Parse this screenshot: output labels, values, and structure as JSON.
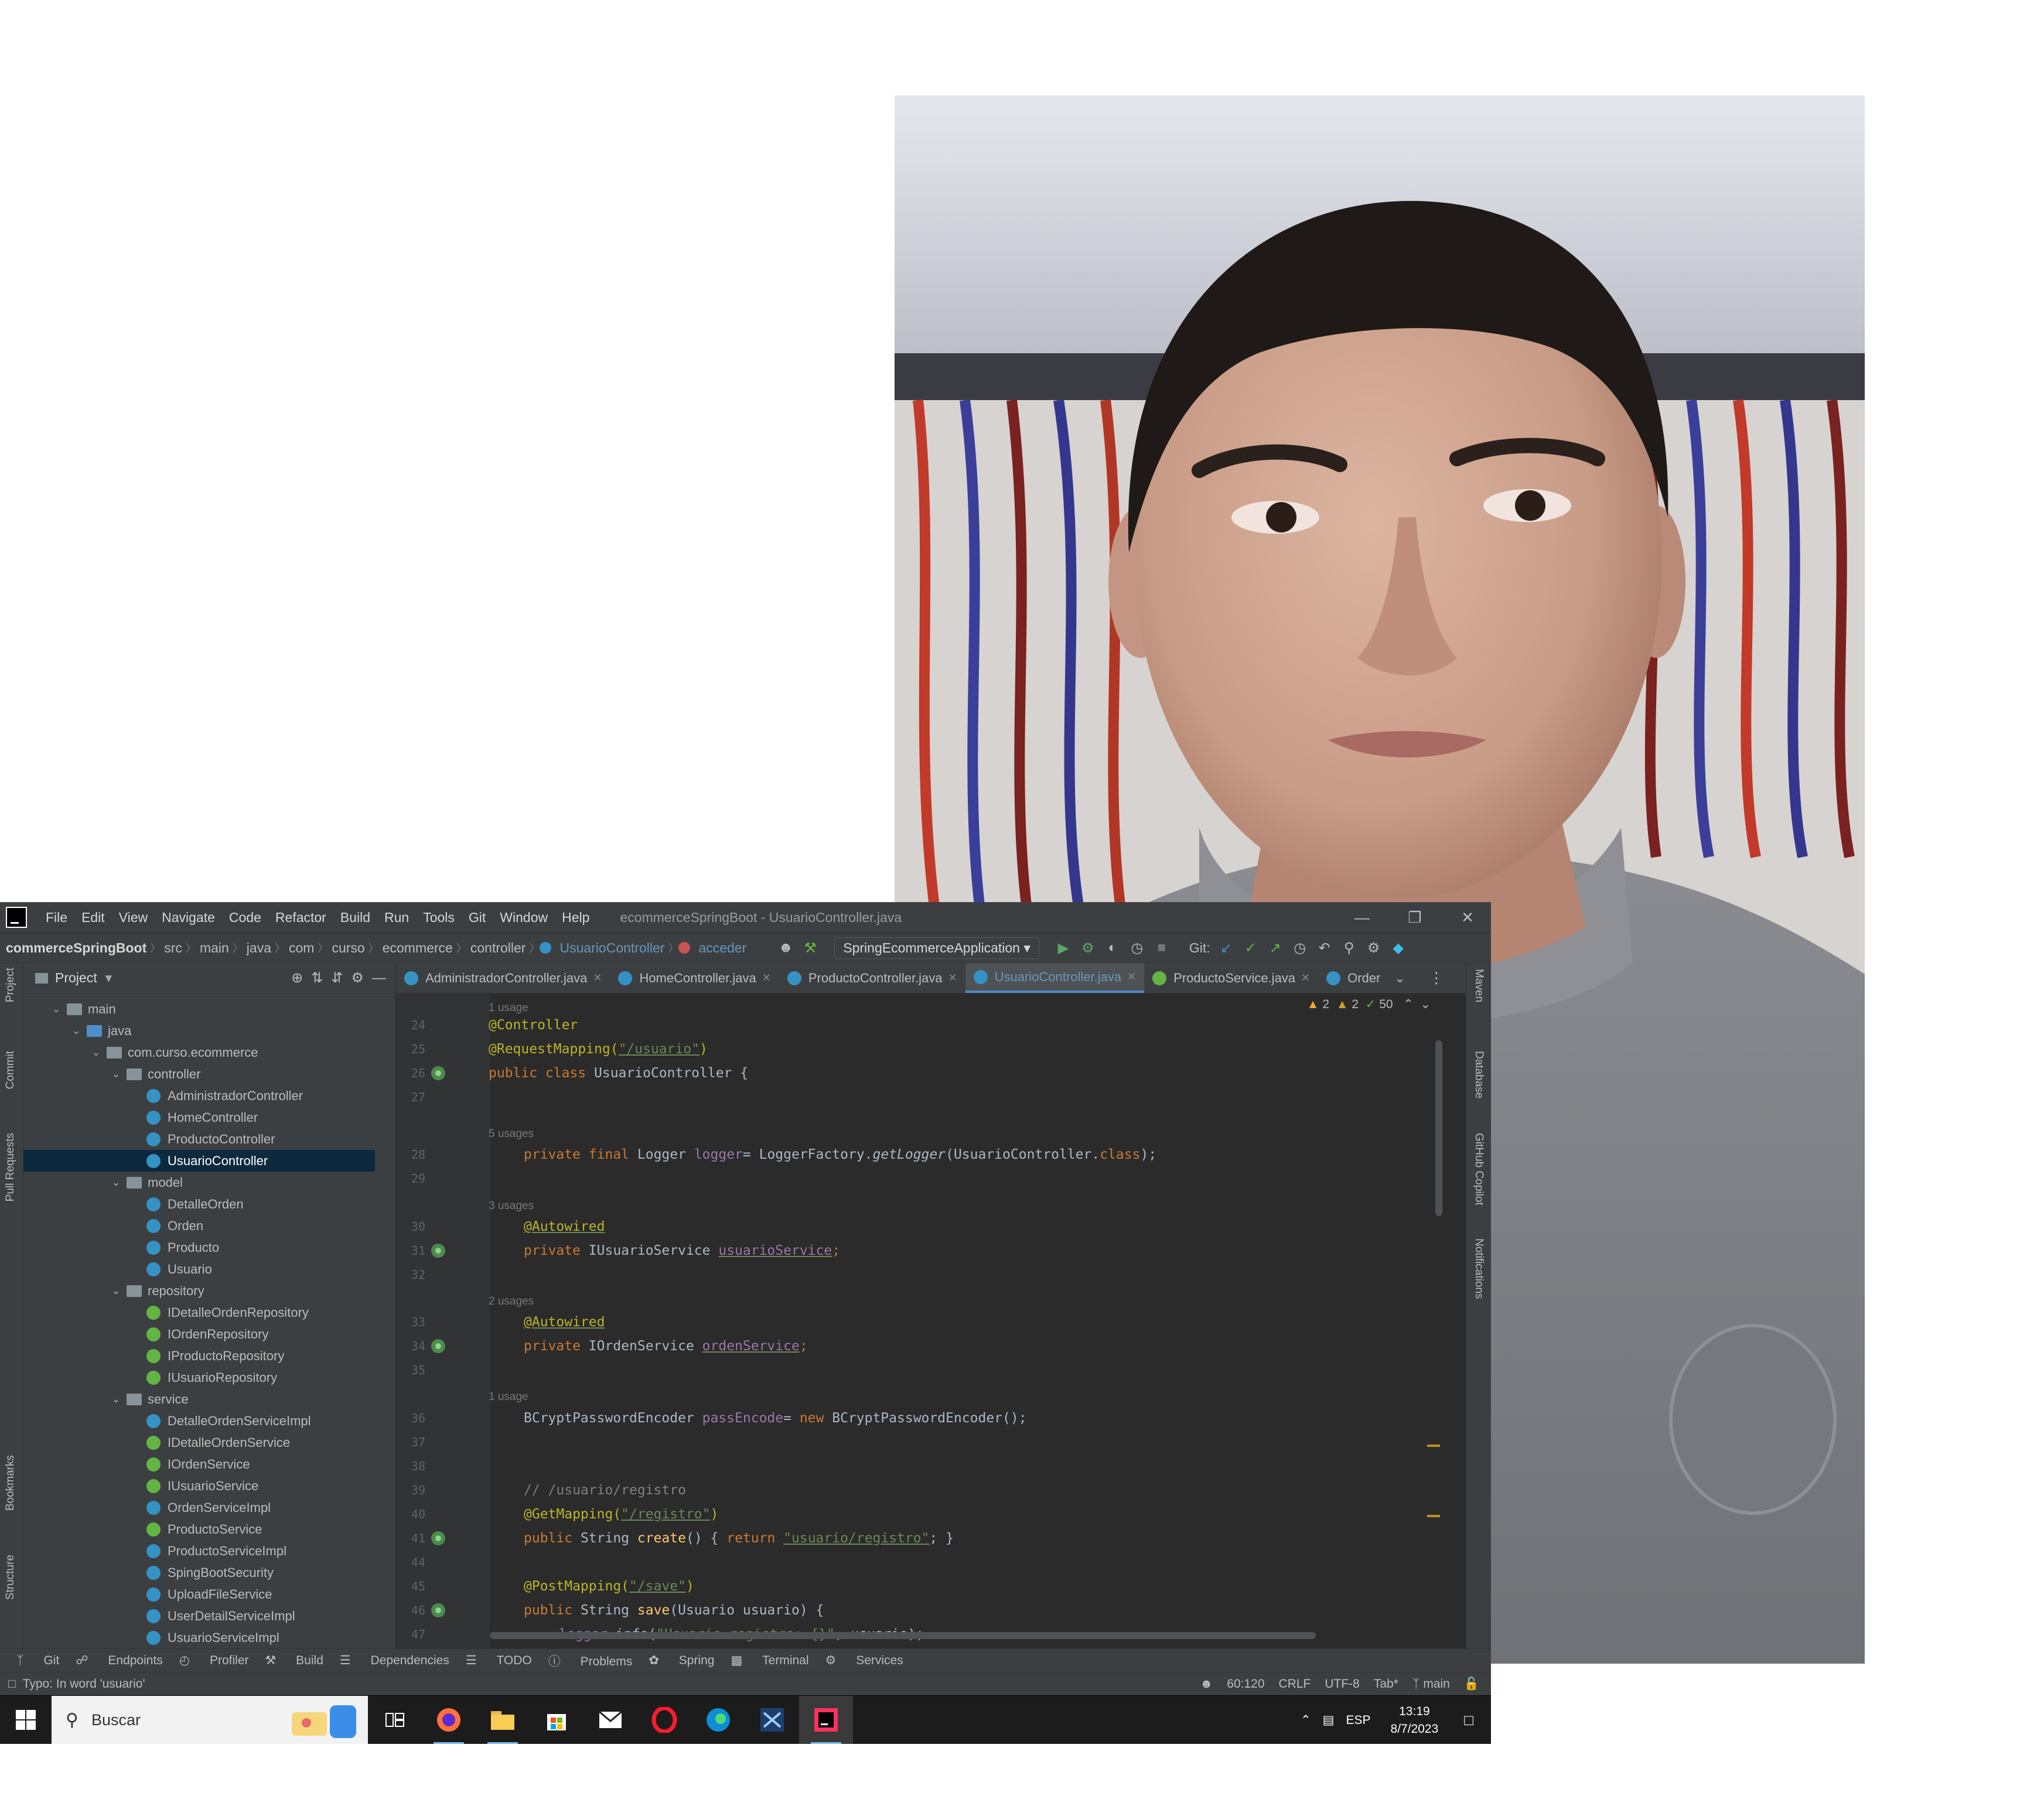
{
  "ide": {
    "menu": [
      "File",
      "Edit",
      "View",
      "Navigate",
      "Code",
      "Refactor",
      "Build",
      "Run",
      "Tools",
      "Git",
      "Window",
      "Help"
    ],
    "window_title": "ecommerceSpringBoot - UsuarioController.java",
    "breadcrumbs": [
      "commerceSpringBoot",
      "src",
      "main",
      "java",
      "com",
      "curso",
      "ecommerce",
      "controller"
    ],
    "breadcrumb_class": "UsuarioController",
    "breadcrumb_method": "acceder",
    "run_config": "SpringEcommerceApplication",
    "git_label": "Git:",
    "project_label": "Project",
    "left_stripe": [
      "Project",
      "Commit",
      "Pull Requests",
      "Bookmarks",
      "Structure"
    ],
    "right_stripe": [
      "Maven",
      "Database",
      "GitHub Copilot",
      "Notifications"
    ],
    "tree": [
      {
        "label": "main",
        "type": "folder",
        "depth": 0
      },
      {
        "label": "java",
        "type": "folder-blue",
        "depth": 1
      },
      {
        "label": "com.curso.ecommerce",
        "type": "folder",
        "depth": 2
      },
      {
        "label": "controller",
        "type": "folder",
        "depth": 3
      },
      {
        "label": "AdministradorController",
        "type": "class",
        "depth": 4
      },
      {
        "label": "HomeController",
        "type": "class",
        "depth": 4
      },
      {
        "label": "ProductoController",
        "type": "class",
        "depth": 4
      },
      {
        "label": "UsuarioController",
        "type": "class",
        "depth": 4,
        "selected": true
      },
      {
        "label": "model",
        "type": "folder",
        "depth": 3
      },
      {
        "label": "DetalleOrden",
        "type": "class",
        "depth": 4
      },
      {
        "label": "Orden",
        "type": "class",
        "depth": 4
      },
      {
        "label": "Producto",
        "type": "class",
        "depth": 4
      },
      {
        "label": "Usuario",
        "type": "class",
        "depth": 4
      },
      {
        "label": "repository",
        "type": "folder",
        "depth": 3
      },
      {
        "label": "IDetalleOrdenRepository",
        "type": "interface",
        "depth": 4
      },
      {
        "label": "IOrdenRepository",
        "type": "interface",
        "depth": 4
      },
      {
        "label": "IProductoRepository",
        "type": "interface",
        "depth": 4
      },
      {
        "label": "IUsuarioRepository",
        "type": "interface",
        "depth": 4
      },
      {
        "label": "service",
        "type": "folder",
        "depth": 3
      },
      {
        "label": "DetalleOrdenServiceImpl",
        "type": "class",
        "depth": 4
      },
      {
        "label": "IDetalleOrdenService",
        "type": "interface",
        "depth": 4
      },
      {
        "label": "IOrdenService",
        "type": "interface",
        "depth": 4
      },
      {
        "label": "IUsuarioService",
        "type": "interface",
        "depth": 4
      },
      {
        "label": "OrdenServiceImpl",
        "type": "class",
        "depth": 4
      },
      {
        "label": "ProductoService",
        "type": "interface",
        "depth": 4
      },
      {
        "label": "ProductoServiceImpl",
        "type": "class",
        "depth": 4
      },
      {
        "label": "SpingBootSecurity",
        "type": "class",
        "depth": 4
      },
      {
        "label": "UploadFileService",
        "type": "class",
        "depth": 4
      },
      {
        "label": "UserDetailServiceImpl",
        "type": "class",
        "depth": 4
      },
      {
        "label": "UsuarioServiceImpl",
        "type": "class",
        "depth": 4
      }
    ],
    "tabs": [
      {
        "label": "AdministradorController.java",
        "icon": "class"
      },
      {
        "label": "HomeController.java",
        "icon": "class"
      },
      {
        "label": "ProductoController.java",
        "icon": "class"
      },
      {
        "label": "UsuarioController.java",
        "icon": "class",
        "active": true
      },
      {
        "label": "ProductoService.java",
        "icon": "interface"
      },
      {
        "label": "Order",
        "icon": "class"
      }
    ],
    "inspections": {
      "warn1": "2",
      "warn2": "2",
      "ok": "50"
    },
    "hints": {
      "h24": "1 usage",
      "h28": "5 usages",
      "h30": "3 usages",
      "h33": "2 usages",
      "h36": "1 usage"
    },
    "line_numbers": [
      "24",
      "25",
      "26",
      "27",
      "28",
      "29",
      "30",
      "31",
      "32",
      "33",
      "34",
      "35",
      "36",
      "37",
      "38",
      "39",
      "40",
      "41",
      "44",
      "45",
      "46",
      "47"
    ],
    "code": {
      "l24": "@Controller",
      "l25a": "@RequestMapping(",
      "l25b": "\"/usuario\"",
      "l25c": ")",
      "l26a": "public class ",
      "l26b": "UsuarioController",
      "l26c": " {",
      "l28a": "private final ",
      "l28b": "Logger ",
      "l28c": "logger",
      "l28d": "= LoggerFactory.",
      "l28e": "getLogger",
      "l28f": "(UsuarioController.",
      "l28g": "class",
      "l28h": ");",
      "l30": "@Autowired",
      "l31a": "private ",
      "l31b": "IUsuarioService ",
      "l31c": "usuarioService",
      "l31d": ";",
      "l33": "@Autowired",
      "l34a": "private ",
      "l34b": "IOrdenService ",
      "l34c": "ordenService",
      "l34d": ";",
      "l36a": "BCryptPasswordEncoder ",
      "l36b": "passEncode",
      "l36c": "= ",
      "l36d": "new ",
      "l36e": "BCryptPasswordEncoder();",
      "l39": "// /usuario/registro",
      "l40a": "@GetMapping(",
      "l40b": "\"/registro\"",
      "l40c": ")",
      "l41a": "public ",
      "l41b": "String ",
      "l41c": "create",
      "l41d": "() { ",
      "l41e": "return ",
      "l41f": "\"usuario/registro\"",
      "l41g": "; }",
      "l45a": "@PostMapping(",
      "l45b": "\"/save\"",
      "l45c": ")",
      "l46a": "public ",
      "l46b": "String ",
      "l46c": "save",
      "l46d": "(Usuario usuario) {",
      "l47a": "logger",
      "l47b": ".info(",
      "l47c": "\"Usuario registro: {}\"",
      "l47d": ", usuario);"
    },
    "toolwindows": [
      "Git",
      "Endpoints",
      "Profiler",
      "Build",
      "Dependencies",
      "TODO",
      "Problems",
      "Spring",
      "Terminal",
      "Services"
    ],
    "status": {
      "message": "Typo: In word 'usuario'",
      "position": "60:120",
      "line_sep": "CRLF",
      "encoding": "UTF-8",
      "indent": "Tab*",
      "branch": "main"
    }
  },
  "taskbar": {
    "search_placeholder": "Buscar",
    "lang": "ESP",
    "time": "13:19",
    "date": "8/7/2023"
  },
  "colors": {
    "accent": "#4a88c7",
    "editor_bg": "#2b2b2b",
    "panel_bg": "#3c3f41",
    "taskbar_bg": "#1c1c1c"
  }
}
